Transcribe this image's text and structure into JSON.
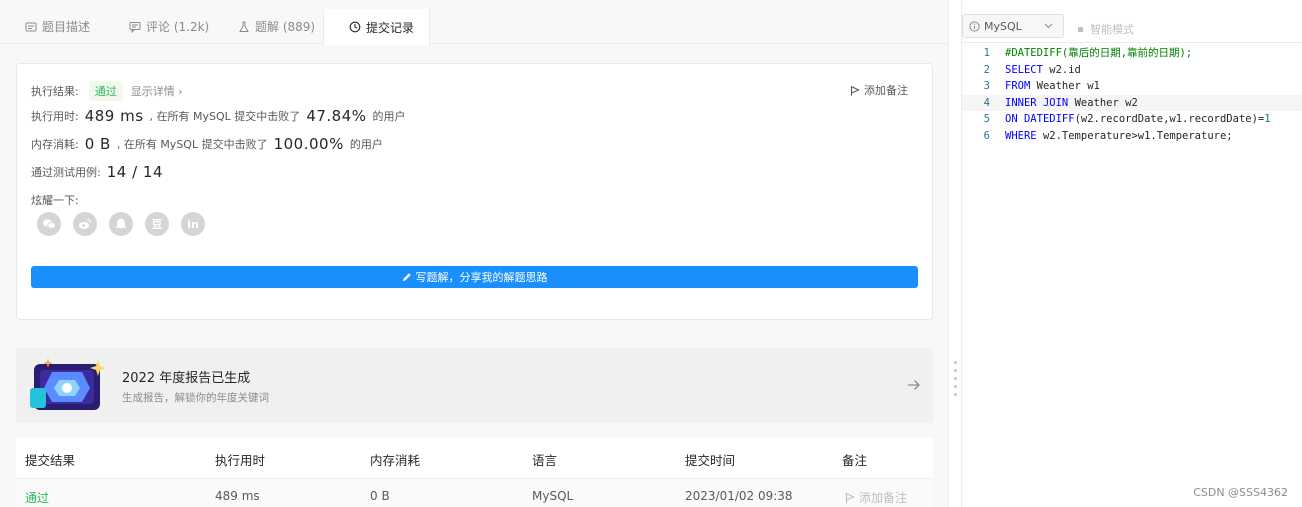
{
  "tabs": [
    {
      "label": "题目描述",
      "icon": "description-icon"
    },
    {
      "label": "评论 (1.2k)",
      "icon": "comment-icon"
    },
    {
      "label": "题解 (889)",
      "icon": "flask-icon"
    },
    {
      "label": "提交记录",
      "icon": "clock-icon"
    }
  ],
  "result": {
    "status_label": "执行结果:",
    "status_value": "通过",
    "detail_link": "显示详情 ›",
    "add_note": "添加备注",
    "time_label": "执行用时:",
    "time_value": "489 ms",
    "time_mid": ", 在所有 MySQL 提交中击败了",
    "time_percent": "47.84%",
    "time_suffix": "的用户",
    "mem_label": "内存消耗:",
    "mem_value": "0 B",
    "mem_mid": ", 在所有 MySQL 提交中击败了",
    "mem_percent": "100.00%",
    "mem_suffix": "的用户",
    "tests_label": "通过测试用例:",
    "tests_value": "14 / 14",
    "share_label": "炫耀一下:",
    "share_icons": [
      "wechat-icon",
      "weibo-icon",
      "qq-icon",
      "douban-icon",
      "linkedin-icon"
    ],
    "write_button": "写题解，分享我的解题思路"
  },
  "report": {
    "title": "2022 年度报告已生成",
    "subtitle": "生成报告，解锁你的年度关键词"
  },
  "table": {
    "headers": [
      "提交结果",
      "执行用时",
      "内存消耗",
      "语言",
      "提交时间",
      "备注"
    ],
    "row": {
      "result": "通过",
      "time": "489 ms",
      "memory": "0 B",
      "language": "MySQL",
      "submitted": "2023/01/02 09:38",
      "note": "添加备注"
    }
  },
  "editor": {
    "language": "MySQL",
    "smart_mode": "智能模式",
    "lines": [
      {
        "num": "1",
        "text": "#DATEDIFF(靠后的日期,靠前的日期);"
      },
      {
        "num": "2",
        "text": "SELECT w2.id"
      },
      {
        "num": "3",
        "text": "FROM Weather w1"
      },
      {
        "num": "4",
        "text": "INNER JOIN Weather w2"
      },
      {
        "num": "5",
        "text": "ON DATEDIFF(w2.recordDate,w1.recordDate)=1"
      },
      {
        "num": "6",
        "text": "WHERE w2.Temperature>w1.Temperature;"
      }
    ]
  },
  "watermark": "CSDN @SSS4362",
  "colors": {
    "accent": "#1a90ff",
    "pass": "#2db55d",
    "keyword": "#0000ff",
    "comment": "#008000"
  }
}
